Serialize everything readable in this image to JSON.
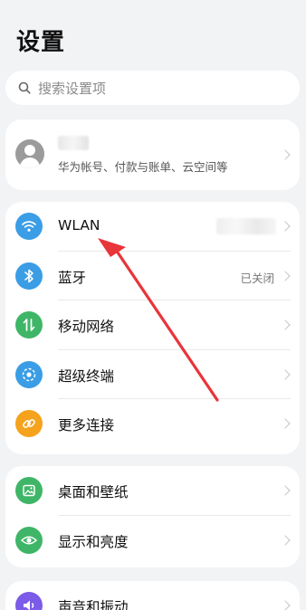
{
  "header": {
    "title": "设置"
  },
  "search": {
    "placeholder": "搜索设置项",
    "icon": "search-icon"
  },
  "account": {
    "subtitle": "华为帐号、付款与账单、云空间等",
    "avatar_icon": "avatar-icon"
  },
  "network_group": {
    "items": [
      {
        "label": "WLAN",
        "value": "",
        "icon": "wifi-icon",
        "color": "#3a9de6"
      },
      {
        "label": "蓝牙",
        "value": "已关闭",
        "icon": "bluetooth-icon",
        "color": "#3a9de6"
      },
      {
        "label": "移动网络",
        "value": "",
        "icon": "mobile-network-icon",
        "color": "#3fb667"
      },
      {
        "label": "超级终端",
        "value": "",
        "icon": "super-device-icon",
        "color": "#3a9de6"
      },
      {
        "label": "更多连接",
        "value": "",
        "icon": "link-icon",
        "color": "#f5a21d"
      }
    ]
  },
  "display_group": {
    "items": [
      {
        "label": "桌面和壁纸",
        "icon": "wallpaper-icon",
        "color": "#3fb667"
      },
      {
        "label": "显示和亮度",
        "icon": "eye-icon",
        "color": "#3fb667"
      }
    ]
  },
  "sound_group": {
    "items": [
      {
        "label": "声音和振动",
        "icon": "volume-icon",
        "color": "#7b5be8"
      }
    ]
  },
  "annotation": {
    "arrow_color": "#e8353a"
  }
}
